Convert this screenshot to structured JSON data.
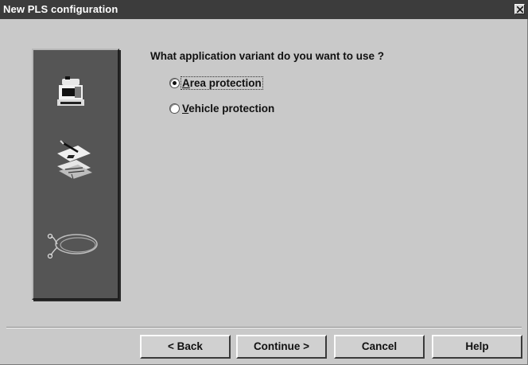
{
  "window": {
    "title": "New PLS configuration"
  },
  "question": "What application variant do you want to use ?",
  "options": [
    {
      "label": "Area protection",
      "accelerator": "A",
      "selected": true
    },
    {
      "label": "Vehicle protection",
      "accelerator": "V",
      "selected": false
    }
  ],
  "side_icons": [
    "scanner-device-icon",
    "write-configuration-icon",
    "cable-connection-icon"
  ],
  "buttons": {
    "back": "< Back",
    "continue": "Continue >",
    "cancel": "Cancel",
    "help": "Help"
  }
}
